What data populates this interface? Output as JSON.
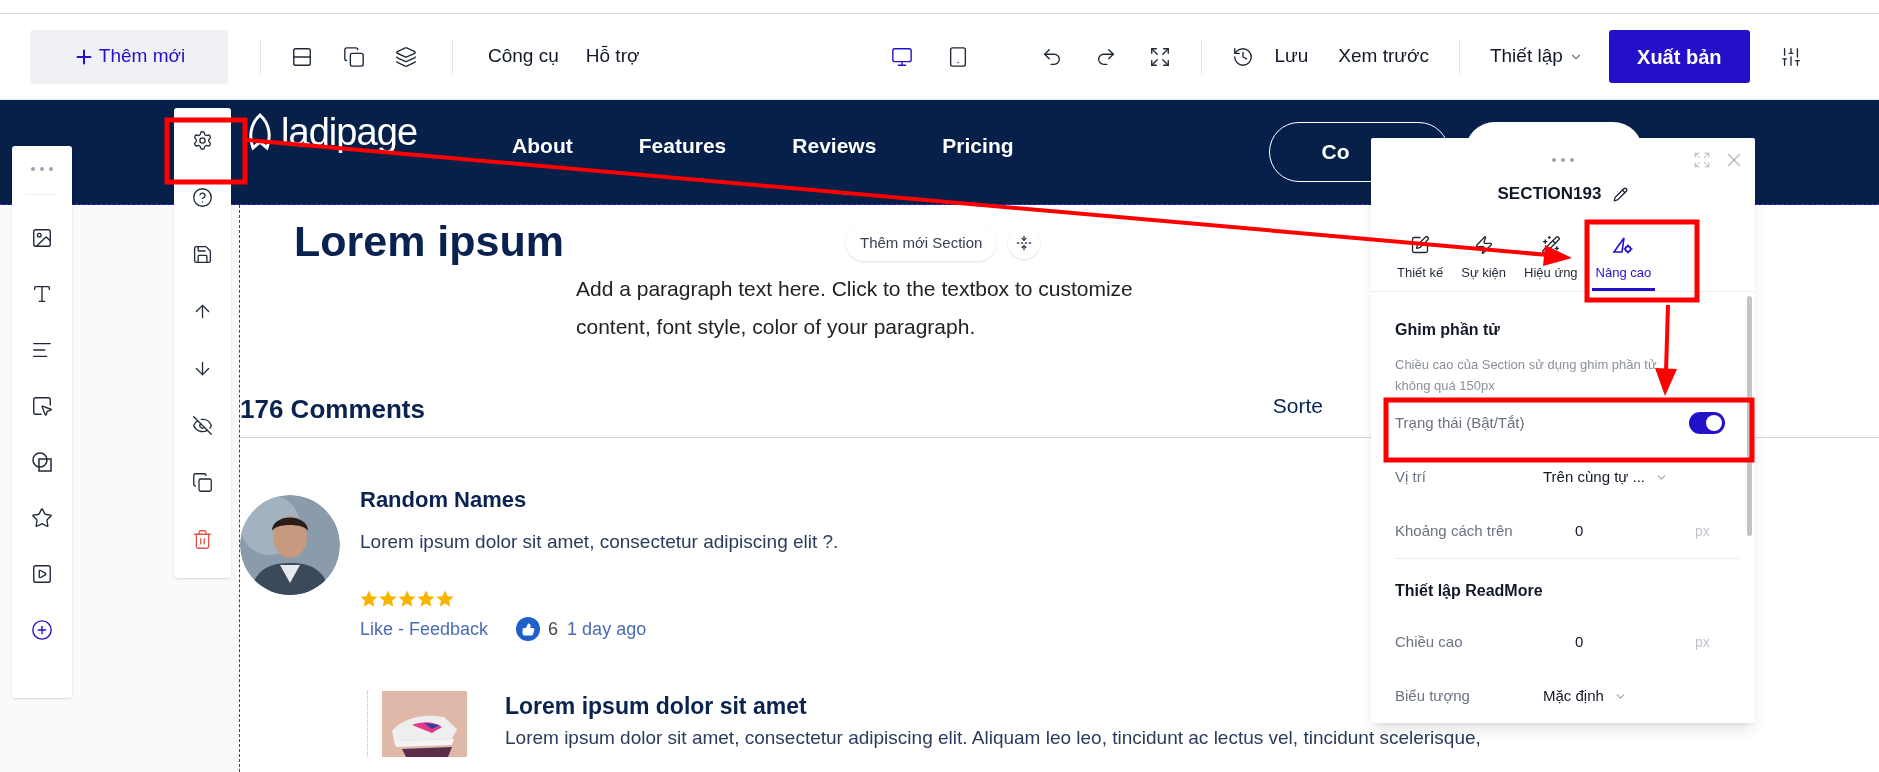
{
  "toolbar": {
    "add_label": "Thêm mới",
    "menus": [
      "Công cụ",
      "Hỗ trợ"
    ],
    "devices": [
      {
        "kind": "desktop",
        "selected": true
      },
      {
        "kind": "tablet",
        "selected": false
      }
    ],
    "save": "Lưu",
    "preview": "Xem trước",
    "settings": "Thiết lập",
    "publish": "Xuất bản"
  },
  "header": {
    "logo": "ladipage",
    "nav": [
      "About",
      "Features",
      "Reviews",
      "Pricing"
    ],
    "button": "Co"
  },
  "add_section": "Thêm mới Section",
  "hero": {
    "title": "Lorem ipsum",
    "paragraph": "Add a paragraph text here. Click to the textbox to customize content, font style, color of your paragraph."
  },
  "comments": {
    "count": "176 Comments",
    "sort": "Sorte",
    "items": [
      {
        "name": "Random Names",
        "text": "Lorem ipsum dolor sit amet, consectetur adipiscing elit ?.",
        "stars": 5,
        "link": "Like - Feedback",
        "likes": "6",
        "time": "1 day ago"
      }
    ],
    "product": {
      "title": "Lorem ipsum dolor sit amet",
      "text": "Lorem ipsum dolor sit amet, consectetur adipiscing elit. Aliquam leo leo, tincidunt ac lectus vel, tincidunt scelerisque,"
    }
  },
  "panel": {
    "title": "SECTION193",
    "tabs": [
      {
        "kind": "design",
        "label": "Thiết kế",
        "selected": false
      },
      {
        "kind": "event",
        "label": "Sự kiện",
        "selected": false
      },
      {
        "kind": "effect",
        "label": "Hiệu ứng",
        "selected": false
      },
      {
        "kind": "advanced",
        "label": "Nâng cao",
        "selected": true
      }
    ],
    "sections": [
      {
        "title": "Ghim phần tử",
        "note": "Chiều cao của Section sử dụng ghim phần tử không quá 150px",
        "rows": [
          {
            "kind": "toggle",
            "label": "Trạng thái (Bật/Tắt)",
            "on": true
          },
          {
            "kind": "select",
            "label": "Vị trí",
            "value": "Trên cùng tự ..."
          },
          {
            "kind": "number",
            "label": "Khoảng cách trên",
            "value": "0",
            "unit": "px"
          }
        ]
      },
      {
        "title": "Thiết lập ReadMore",
        "rows": [
          {
            "kind": "number",
            "label": "Chiều cao",
            "value": "0",
            "unit": "px"
          },
          {
            "kind": "select",
            "label": "Biểu tượng",
            "value": "Mặc định"
          }
        ]
      }
    ]
  }
}
